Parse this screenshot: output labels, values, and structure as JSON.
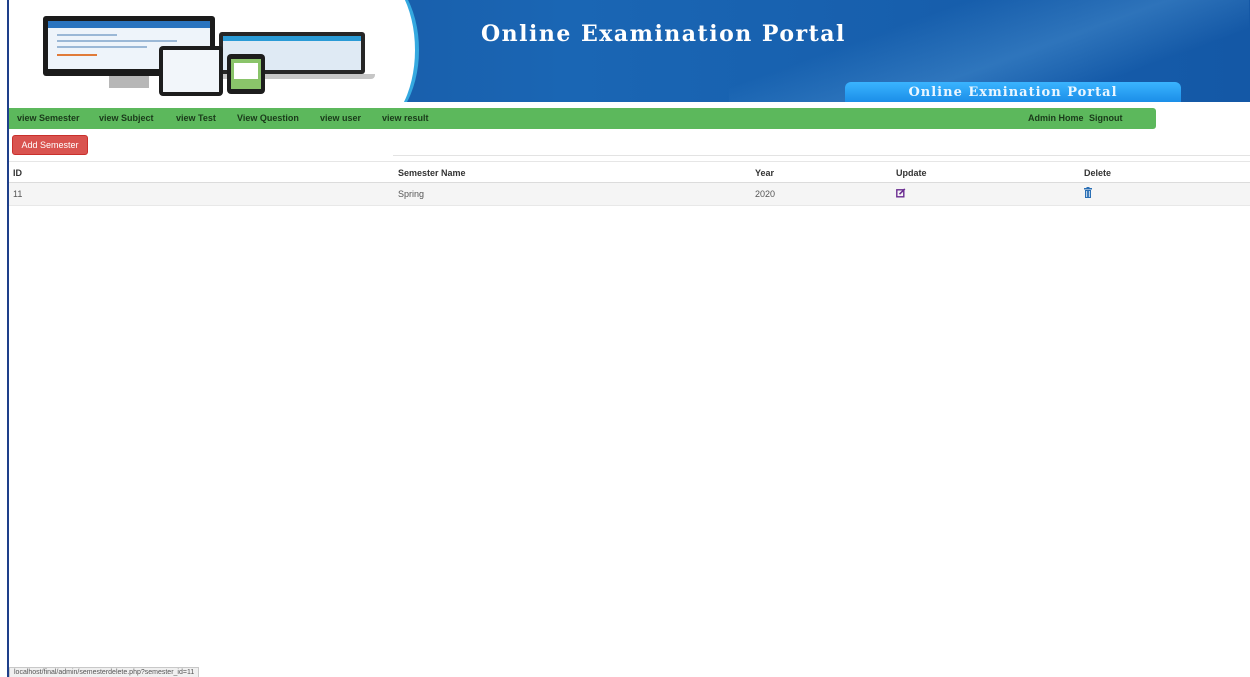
{
  "banner": {
    "title": "Online Examination Portal",
    "subtitle": "Online Exmination Portal"
  },
  "nav": {
    "items": [
      {
        "label": "view Semester"
      },
      {
        "label": "view Subject"
      },
      {
        "label": "view Test"
      },
      {
        "label": "View Question"
      },
      {
        "label": "view user"
      },
      {
        "label": "view result"
      }
    ],
    "right": [
      {
        "label": "Admin Home"
      },
      {
        "label": "Signout"
      }
    ]
  },
  "actions": {
    "add_label": "Add Semester"
  },
  "table": {
    "headers": [
      "ID",
      "Semester Name",
      "Year",
      "Update",
      "Delete"
    ],
    "rows": [
      {
        "id": "11",
        "name": "Spring",
        "year": "2020",
        "update_icon": "edit-icon",
        "delete_icon": "trash-icon"
      }
    ]
  },
  "status": {
    "url": "localhost/final/admin/semesterdelete.php?semester_id=11"
  },
  "colors": {
    "nav_green": "#5cb85c",
    "button_red": "#d9534f",
    "banner_blue": "#1a66b4",
    "edit_purple": "#6b2c91",
    "trash_blue": "#2a6fb5"
  }
}
